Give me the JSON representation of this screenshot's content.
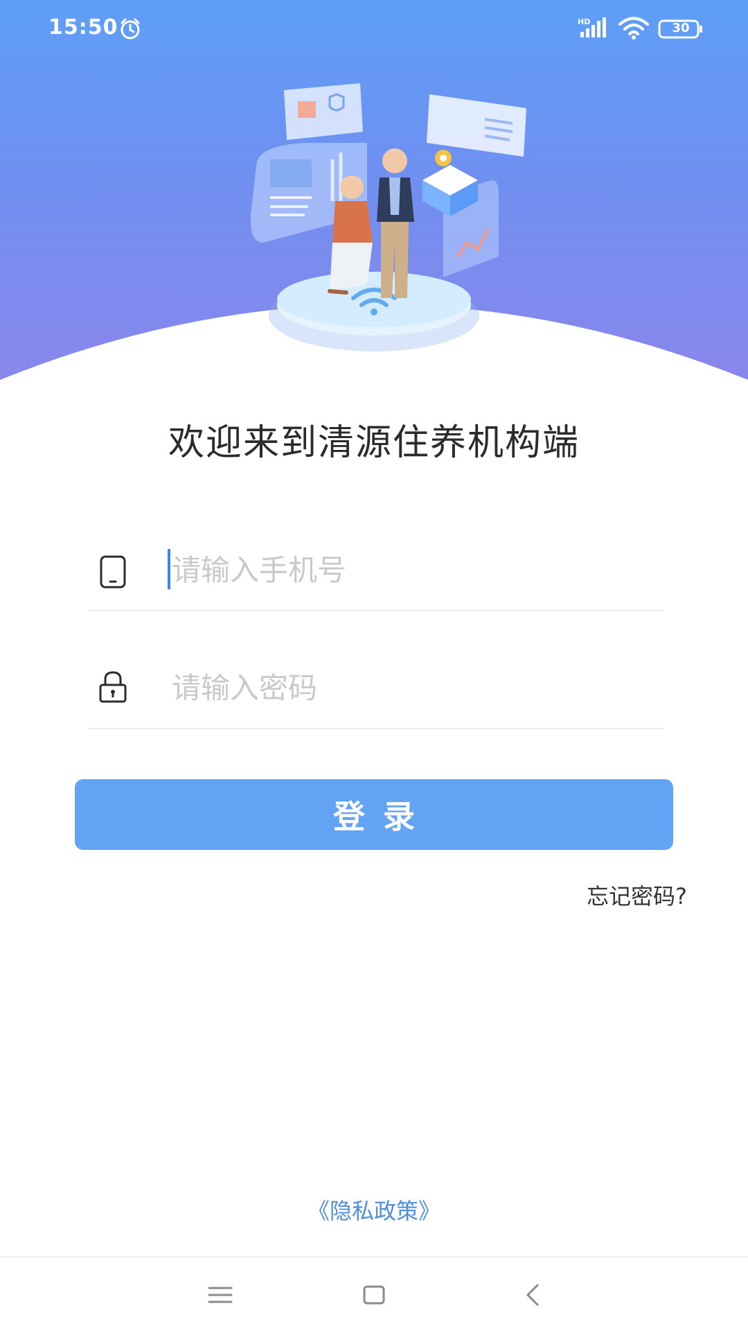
{
  "status_bar": {
    "time": "15:50",
    "network_label": "HD",
    "battery_level": "30"
  },
  "login": {
    "welcome_title": "欢迎来到清源住养机构端",
    "phone_placeholder": "请输入手机号",
    "password_placeholder": "请输入密码",
    "login_label": "登录",
    "forgot_password": "忘记密码?",
    "privacy_policy": "《隐私政策》"
  },
  "colors": {
    "header_gradient_top": "#5e9ff7",
    "header_gradient_bottom": "#8a86ec",
    "primary_button": "#62a3f3",
    "link_blue": "#4e8fd8",
    "cursor_blue": "#3f83e8"
  },
  "icons": {
    "phone_field": "mobile-phone-icon",
    "password_field": "lock-icon",
    "status_alarm": "alarm-clock-icon",
    "status_signal": "cell-signal-icon",
    "status_wifi": "wifi-icon",
    "status_battery": "battery-icon",
    "nav_menu": "menu-icon",
    "nav_home": "home-square-icon",
    "nav_back": "back-chevron-icon"
  }
}
